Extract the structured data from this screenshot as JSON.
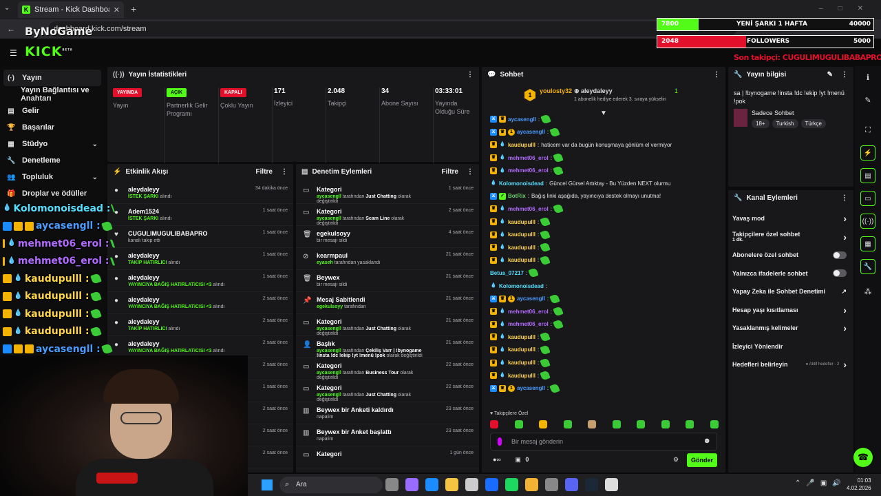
{
  "browser": {
    "tab_title": "Stream - Kick Dashboard",
    "url": "dashboard.kick.com/stream",
    "new_tab": "+"
  },
  "overlay": {
    "watermark": "ByNoGame",
    "bar1_left": "7800",
    "bar1_label": "YENİ ŞARKI 1 HAFTA",
    "bar1_right": "40000",
    "bar1_fill": 0.19,
    "bar2_left": "2048",
    "bar2_label": "FOLLOWERS",
    "bar2_right": "5000",
    "bar2_fill": 0.41,
    "last_follower": "Son takipçi: CUGULIMUGULIBABAPRO",
    "chat_overlay": [
      {
        "name": "Kolomonoisdead :",
        "color": "#55e0ff",
        "badges": [
          "drop"
        ]
      },
      {
        "name": "aycasengll :",
        "color": "#4a9cff",
        "badges": [
          "blue",
          "one",
          "crown"
        ]
      },
      {
        "name": "mehmet06_erol :",
        "color": "#b36bff",
        "badges": [
          "crown",
          "drop"
        ]
      },
      {
        "name": "mehmet06_erol :",
        "color": "#b36bff",
        "badges": [
          "crown",
          "drop"
        ]
      },
      {
        "name": "kaudupulll :",
        "color": "#ffd54a",
        "badges": [
          "crown",
          "drop"
        ]
      },
      {
        "name": "kaudupulll :",
        "color": "#ffd54a",
        "badges": [
          "crown",
          "drop"
        ]
      },
      {
        "name": "kaudupulll :",
        "color": "#ffd54a",
        "badges": [
          "crown",
          "drop"
        ]
      },
      {
        "name": "kaudupulll :",
        "color": "#ffd54a",
        "badges": [
          "crown",
          "drop"
        ]
      },
      {
        "name": "aycasengll :",
        "color": "#4a9cff",
        "badges": [
          "blue",
          "one",
          "crown"
        ]
      }
    ]
  },
  "header": {
    "logo": "KICK",
    "logo_sup": "BETA"
  },
  "nav": [
    {
      "label": "Yayın",
      "icon": "(·)",
      "active": true
    },
    {
      "label": "Yayın Bağlantısı ve Anahtarı",
      "icon": ""
    },
    {
      "label": "Gelir",
      "icon": "▤"
    },
    {
      "label": "Başarılar",
      "icon": "🏆"
    },
    {
      "label": "Stüdyo",
      "icon": "▦",
      "chevron": true
    },
    {
      "label": "Denetleme",
      "icon": "🔧"
    },
    {
      "label": "Topluluk",
      "icon": "👥",
      "chevron": true
    },
    {
      "label": "Droplar ve ödüller",
      "icon": "🎁"
    }
  ],
  "stats": {
    "title": "Yayın İstatistikleri",
    "cols": [
      {
        "badge": "YAYINDA",
        "label": "Yayın",
        "kind": "red"
      },
      {
        "badge": "AÇIK",
        "label": "Partnerlik Gelir Programı",
        "kind": "green"
      },
      {
        "badge": "KAPALI",
        "label": "Çoklu Yayın",
        "kind": "red"
      },
      {
        "value": "171",
        "label": "İzleyici"
      },
      {
        "value": "2.048",
        "label": "Takipçi"
      },
      {
        "value": "34",
        "label": "Abone Sayısı"
      },
      {
        "value": "03:33:01",
        "label": "Yayında Olduğu Süre"
      }
    ]
  },
  "activity": {
    "title": "Etkinlik Akışı",
    "filter": "Filtre",
    "items": [
      {
        "name": "aleydaleyy",
        "sub": "İSTEK ŞARKI",
        "suffix": "alındı",
        "time": "34 dakika önce",
        "icon": "●"
      },
      {
        "name": "Adem1524",
        "sub": "İSTEK ŞARKI",
        "suffix": "alındı",
        "time": "1 saat önce",
        "icon": "●"
      },
      {
        "name": "CUGULIMUGULIBABAPRO",
        "sub": "",
        "suffix": "kanalı takip etti",
        "time": "1 saat önce",
        "icon": "♥"
      },
      {
        "name": "aleydaleyy",
        "sub": "TAKİP HATIRLICI",
        "suffix": "alındı",
        "time": "1 saat önce",
        "icon": "●"
      },
      {
        "name": "aleydaleyy",
        "sub": "YAYINCIYA BAĞIŞ HATIRLATICISI &lt;3",
        "suffix": "alındı",
        "time": "1 saat önce",
        "icon": "●"
      },
      {
        "name": "aleydaleyy",
        "sub": "YAYINCIYA BAĞIŞ HATIRLATICISI &lt;3",
        "suffix": "alındı",
        "time": "2 saat önce",
        "icon": "●"
      },
      {
        "name": "aleydaleyy",
        "sub": "TAKİP HATIRLICI",
        "suffix": "alındı",
        "time": "2 saat önce",
        "icon": "●"
      },
      {
        "name": "aleydaleyy",
        "sub": "YAYINCIYA BAĞIŞ HATIRLATICISI &lt;3",
        "suffix": "alındı",
        "time": "2 saat önce",
        "icon": "●"
      },
      {
        "name": "",
        "sub": "",
        "suffix": "",
        "time": "2 saat önce",
        "icon": ""
      },
      {
        "name": "",
        "sub": "",
        "suffix": "",
        "time": "1 saat önce",
        "icon": ""
      },
      {
        "name": "",
        "sub": "",
        "suffix": "",
        "time": "2 saat önce",
        "icon": ""
      },
      {
        "name": "",
        "sub": "",
        "suffix": "",
        "time": "2 saat önce",
        "icon": ""
      },
      {
        "name": "",
        "sub": "",
        "suffix": "",
        "time": "2 saat önce",
        "icon": ""
      }
    ]
  },
  "moderation": {
    "title": "Denetim Eylemleri",
    "filter": "Filtre",
    "items": [
      {
        "title": "Kategori",
        "user": "aycasengll",
        "mid": "tarafından",
        "hl": "Just Chatting",
        "end": "olarak değiştirildi",
        "time": "1 saat önce",
        "icon": "▭"
      },
      {
        "title": "Kategori",
        "user": "aycasengll",
        "mid": "tarafından",
        "hl": "Scam Line",
        "end": "olarak değiştirildi",
        "time": "2 saat önce",
        "icon": "▭"
      },
      {
        "title": "egekulsoyy",
        "user": "",
        "mid": "bir mesajı sildi",
        "hl": "",
        "end": "",
        "time": "4 saat önce",
        "icon": "🗑"
      },
      {
        "title": "kearmpaul",
        "user": "eyaseh",
        "mid": "tarafından yasaklandı",
        "hl": "",
        "end": "",
        "time": "21 saat önce",
        "icon": "⊘"
      },
      {
        "title": "Beywex",
        "user": "",
        "mid": "bir mesajı sildi",
        "hl": "",
        "end": "",
        "time": "21 saat önce",
        "icon": "🗑"
      },
      {
        "title": "Mesaj Sabitlendi",
        "user": "egekulsoyy",
        "mid": "tarafından",
        "hl": "",
        "end": "",
        "time": "21 saat önce",
        "icon": "📌"
      },
      {
        "title": "Kategori",
        "user": "aycasengll",
        "mid": "tarafından",
        "hl": "Just Chatting",
        "end": "olarak değiştirildi",
        "time": "21 saat önce",
        "icon": "▭"
      },
      {
        "title": "Başlık",
        "user": "aycasengll",
        "mid": "tarafından",
        "hl": "Çekiliş Varr | !bynogame !insta !dc !ekip !yt !menü !pok",
        "end": "olarak değiştirildi",
        "time": "21 saat önce",
        "icon": "👤"
      },
      {
        "title": "Kategori",
        "user": "aycasengll",
        "mid": "tarafından",
        "hl": "Business Tour",
        "end": "olarak değiştirildi",
        "time": "22 saat önce",
        "icon": "▭"
      },
      {
        "title": "Kategori",
        "user": "aycasengll",
        "mid": "tarafından",
        "hl": "Just Chatting",
        "end": "olarak değiştirildi",
        "time": "22 saat önce",
        "icon": "▭"
      },
      {
        "title": "Beywex bir Anketi kaldırdı",
        "user": "",
        "mid": "napalim",
        "hl": "",
        "end": "",
        "time": "23 saat önce",
        "icon": "▥"
      },
      {
        "title": "Beywex bir Anket başlattı",
        "user": "",
        "mid": "napalim",
        "hl": "",
        "end": "",
        "time": "23 saat önce",
        "icon": "▥"
      },
      {
        "title": "Kategori",
        "user": "",
        "mid": "",
        "hl": "",
        "end": "",
        "time": "1 gün önce",
        "icon": "▭"
      }
    ]
  },
  "chat": {
    "title": "Sohbet",
    "pinned_user": "youlosty32",
    "pinned_target": "aleydaleyy",
    "pinned_count": "1",
    "pinned_text": "1 abonelik hediye ederek 3. sıraya yükselin",
    "lines": [
      {
        "user": "aycasengll",
        "cls": "u-blue",
        "badges": [
          "blue",
          "crown"
        ],
        "text": "",
        "emotes": 1
      },
      {
        "user": "aycasengll",
        "cls": "u-blue",
        "badges": [
          "blue",
          "crown",
          "one"
        ],
        "text": "",
        "emotes": 1
      },
      {
        "user": "kaudupulll",
        "cls": "u-yellow",
        "badges": [
          "crown",
          "drop"
        ],
        "text": "haticem var da bugün konuşmaya gönlüm el vermiyor",
        "emotes": 0
      },
      {
        "user": "mehmet06_erol",
        "cls": "u-purple",
        "badges": [
          "crown",
          "drop"
        ],
        "text": "",
        "emotes": 1
      },
      {
        "user": "mehmet06_erol",
        "cls": "u-purple",
        "badges": [
          "crown",
          "drop"
        ],
        "text": "",
        "emotes": 1
      },
      {
        "user": "Kolomonoisdead",
        "cls": "u-teal",
        "badges": [
          "drop"
        ],
        "text": "Güncel Gürsel Artıktay - Bu Yüzden NEXT olurmu",
        "emotes": 0
      },
      {
        "user": "BotRix",
        "cls": "u-green",
        "badges": [
          "blue",
          "green"
        ],
        "text": "Bağış linki aşağıda, yayıncıya destek olmayı unutma!",
        "emotes": 0
      },
      {
        "user": "mehmet06_erol",
        "cls": "u-purple",
        "badges": [
          "crown",
          "drop"
        ],
        "text": "",
        "emotes": 1
      },
      {
        "user": "kaudupulll",
        "cls": "u-yellow",
        "badges": [
          "crown",
          "drop"
        ],
        "text": "",
        "emotes": 1
      },
      {
        "user": "kaudupulll",
        "cls": "u-yellow",
        "badges": [
          "crown",
          "drop"
        ],
        "text": "",
        "emotes": 1
      },
      {
        "user": "kaudupulll",
        "cls": "u-yellow",
        "badges": [
          "crown",
          "drop"
        ],
        "text": "",
        "emotes": 1
      },
      {
        "user": "kaudupulll",
        "cls": "u-yellow",
        "badges": [
          "crown",
          "drop"
        ],
        "text": "",
        "emotes": 1
      },
      {
        "user": "Betus_07217",
        "cls": "u-teal",
        "badges": [],
        "text": "",
        "emotes": 1
      },
      {
        "user": "Kolomonoisdead",
        "cls": "u-teal",
        "badges": [
          "drop"
        ],
        "text": "",
        "emotes": 0
      },
      {
        "user": "aycasengll",
        "cls": "u-blue",
        "badges": [
          "blue",
          "crown",
          "one"
        ],
        "text": "",
        "emotes": 1
      },
      {
        "user": "mehmet06_erol",
        "cls": "u-purple",
        "badges": [
          "crown",
          "drop"
        ],
        "text": "",
        "emotes": 1
      },
      {
        "user": "mehmet06_erol",
        "cls": "u-purple",
        "badges": [
          "crown",
          "drop"
        ],
        "text": "",
        "emotes": 1
      },
      {
        "user": "kaudupulll",
        "cls": "u-yellow",
        "badges": [
          "crown",
          "drop"
        ],
        "text": "",
        "emotes": 1
      },
      {
        "user": "kaudupulll",
        "cls": "u-yellow",
        "badges": [
          "crown",
          "drop"
        ],
        "text": "",
        "emotes": 1
      },
      {
        "user": "kaudupulll",
        "cls": "u-yellow",
        "badges": [
          "crown",
          "drop"
        ],
        "text": "",
        "emotes": 1
      },
      {
        "user": "kaudupulll",
        "cls": "u-yellow",
        "badges": [
          "crown",
          "drop"
        ],
        "text": "",
        "emotes": 1
      },
      {
        "user": "aycasengll",
        "cls": "u-blue",
        "badges": [
          "blue",
          "crown",
          "one"
        ],
        "text": "",
        "emotes": 1
      }
    ],
    "followers_only": "Takipçilere Özel",
    "input_placeholder": "Bir mesaj gönderin",
    "points": "0",
    "send": "Gönder"
  },
  "stream_info": {
    "title": "Yayın bilgisi",
    "stream_title": "sa | !bynogame !insta !dc !ekip !yt !menü !pok",
    "category": "Sadece Sohbet",
    "tags": [
      "18+",
      "Turkish",
      "Türkçe"
    ]
  },
  "channel_actions": {
    "title": "Kanal Eylemleri",
    "items": [
      {
        "label": "Yavaş mod",
        "kind": "chev"
      },
      {
        "label": "Takipçilere özel sohbet",
        "sub": "1 dk.",
        "kind": "chev"
      },
      {
        "label": "Abonelere özel sohbet",
        "kind": "toggle"
      },
      {
        "label": "Yalnızca ifadelerle sohbet",
        "kind": "toggle"
      },
      {
        "label": "Yapay Zeka ile Sohbet Denetimi",
        "kind": "ext"
      },
      {
        "label": "Hesap yaşı kısıtlaması",
        "kind": "chev"
      },
      {
        "label": "Yasaklanmış kelimeler",
        "kind": "chev"
      },
      {
        "label": "İzleyici Yönlendir",
        "kind": "none"
      },
      {
        "label": "Hedefleri belirleyin",
        "kind": "chev",
        "extra": "Aktif hedefler - 2"
      }
    ]
  },
  "taskbar": {
    "search": "Ara",
    "time": "01:03",
    "date": "4.02.2026"
  },
  "colors": {
    "accent": "#53fc18",
    "live_red": "#e3102b",
    "panel": "#18181b"
  }
}
